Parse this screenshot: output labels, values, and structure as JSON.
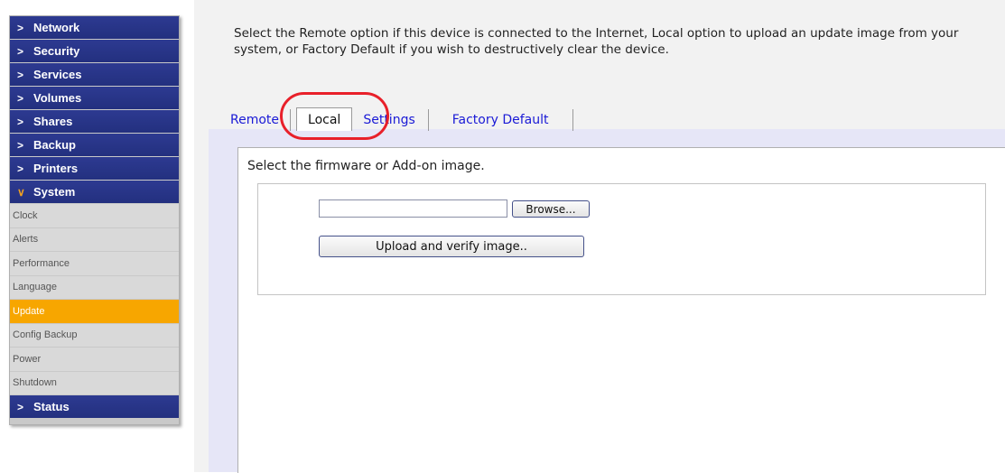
{
  "sidebar": {
    "items_top": [
      {
        "label": "Network"
      },
      {
        "label": "Security"
      },
      {
        "label": "Services"
      },
      {
        "label": "Volumes"
      },
      {
        "label": "Shares"
      },
      {
        "label": "Backup"
      },
      {
        "label": "Printers"
      }
    ],
    "system_label": "System",
    "system_subitems": [
      {
        "label": "Clock"
      },
      {
        "label": "Alerts"
      },
      {
        "label": "Performance"
      },
      {
        "label": "Language"
      },
      {
        "label": "Update",
        "active": true
      },
      {
        "label": "Config Backup"
      },
      {
        "label": "Power"
      },
      {
        "label": "Shutdown"
      }
    ],
    "status_label": "Status",
    "collapsed_icon": "chevron-right-icon",
    "expanded_icon": "chevron-down-icon"
  },
  "main": {
    "description": "Select the Remote option if this device is connected to the Internet, Local option to upload an update image from your system, or Factory Default if you wish to destructively clear the device.",
    "tabs": [
      {
        "label": "Remote"
      },
      {
        "label": "Local",
        "active": true
      },
      {
        "label": "Settings"
      },
      {
        "label": "Factory Default"
      }
    ],
    "section_title": "Select the firmware or Add-on image.",
    "file_input_value": "",
    "browse_label": "Browse...",
    "upload_label": "Upload and verify image.."
  },
  "colors": {
    "nav_bg": "#23307f",
    "active_sub_bg": "#f7a600",
    "tab_link": "#1a1ad6",
    "panel_bg": "#e6e6f7",
    "highlight": "#e8202a"
  }
}
